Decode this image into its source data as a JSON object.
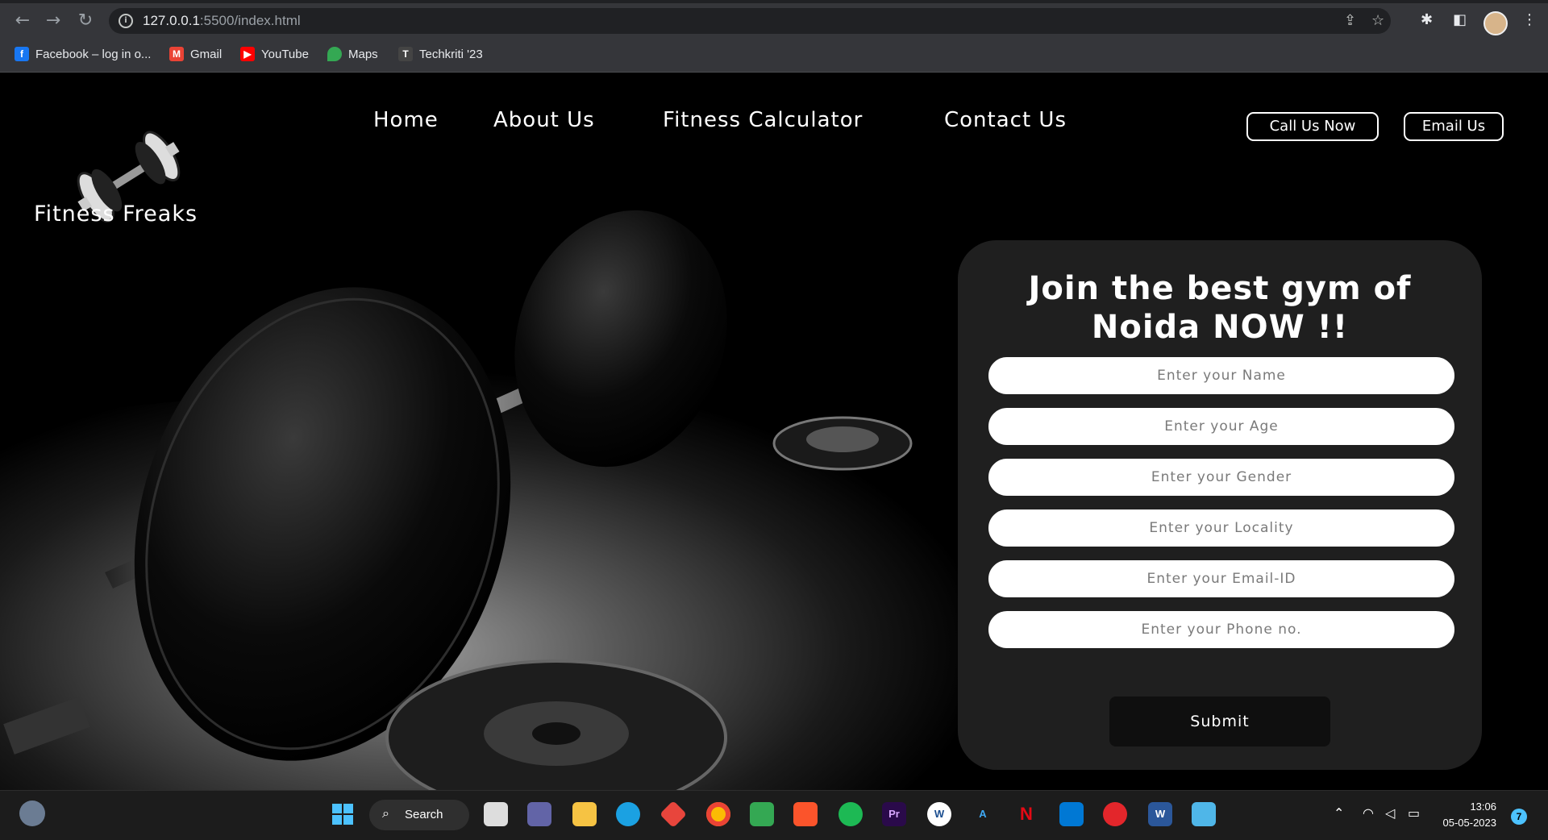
{
  "browser": {
    "url_host": "127.0.0.1",
    "url_rest": ":5500/index.html",
    "bookmarks": [
      {
        "label": "Facebook – log in o...",
        "icon": "facebook-icon",
        "color": "#1877f2",
        "glyph": "f"
      },
      {
        "label": "Gmail",
        "icon": "gmail-icon",
        "color": "#ea4335",
        "glyph": "M"
      },
      {
        "label": "YouTube",
        "icon": "youtube-icon",
        "color": "#ff0000",
        "glyph": "▶"
      },
      {
        "label": "Maps",
        "icon": "maps-icon",
        "color": "#34a853",
        "glyph": "⬤"
      },
      {
        "label": "Techkriti '23",
        "icon": "techkriti-icon",
        "color": "#444444",
        "glyph": "T"
      }
    ]
  },
  "site": {
    "brand": "Fitness Freaks",
    "nav": {
      "home": "Home",
      "about": "About Us",
      "calculator": "Fitness Calculator",
      "contact": "Contact Us"
    },
    "call_button": "Call Us Now",
    "email_button": "Email Us"
  },
  "form": {
    "heading_line1": "Join the best gym of",
    "heading_line2": "Noida NOW !!",
    "name_placeholder": "Enter your Name",
    "age_placeholder": "Enter your Age",
    "gender_placeholder": "Enter your Gender",
    "locality_placeholder": "Enter your Locality",
    "email_placeholder": "Enter your Email-ID",
    "phone_placeholder": "Enter your Phone no.",
    "submit": "Submit"
  },
  "taskbar": {
    "search_label": "Search",
    "time": "13:06",
    "date": "05-05-2023",
    "notifications": "7"
  }
}
